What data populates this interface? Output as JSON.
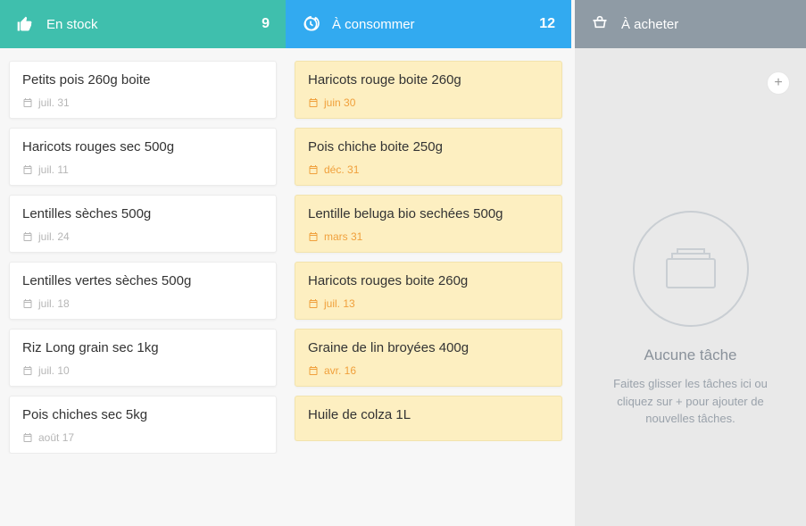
{
  "columns": {
    "stock": {
      "title": "En stock",
      "count": "9",
      "items": [
        {
          "title": "Petits pois 260g boite",
          "date": "juil. 31"
        },
        {
          "title": "Haricots rouges sec 500g",
          "date": "juil. 11"
        },
        {
          "title": "Lentilles sèches 500g",
          "date": "juil. 24"
        },
        {
          "title": "Lentilles vertes sèches 500g",
          "date": "juil. 18"
        },
        {
          "title": "Riz Long grain sec 1kg",
          "date": "juil. 10"
        },
        {
          "title": "Pois chiches sec 5kg",
          "date": "août 17"
        }
      ]
    },
    "consume": {
      "title": "À consommer",
      "count": "12",
      "items": [
        {
          "title": "Haricots rouge boite 260g",
          "date": "juin 30"
        },
        {
          "title": "Pois chiche boite 250g",
          "date": "déc. 31"
        },
        {
          "title": "Lentille beluga bio sechées 500g",
          "date": "mars 31"
        },
        {
          "title": "Haricots rouges boite 260g",
          "date": "juil. 13"
        },
        {
          "title": "Graine de lin broyées 400g",
          "date": "avr. 16"
        },
        {
          "title": "Huile de colza 1L",
          "date": ""
        }
      ]
    },
    "buy": {
      "title": "À acheter",
      "empty_title": "Aucune tâche",
      "empty_sub": "Faites glisser les tâches ici ou cliquez sur + pour ajouter de nouvelles tâches."
    }
  }
}
